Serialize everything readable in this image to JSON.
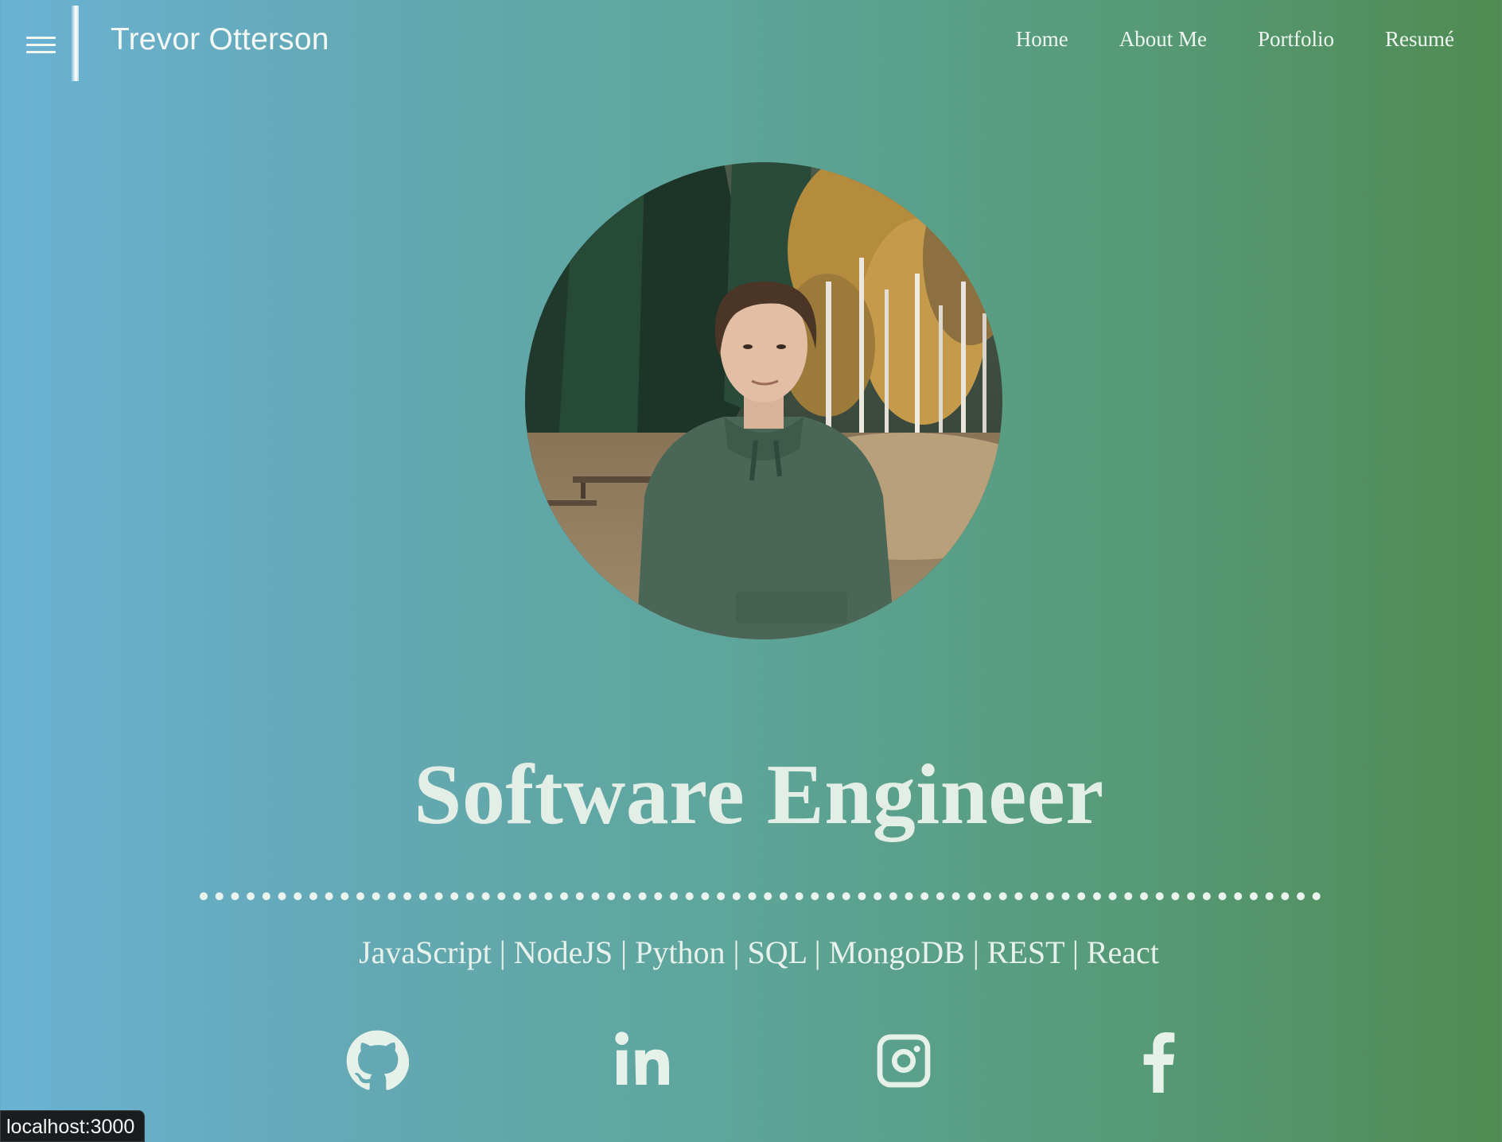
{
  "header": {
    "brand": "Trevor Otterson",
    "nav": [
      {
        "label": "Home"
      },
      {
        "label": "About Me"
      },
      {
        "label": "Portfolio"
      },
      {
        "label": "Resumé"
      }
    ]
  },
  "hero": {
    "title": "Software Engineer",
    "skills": "JavaScript | NodeJS | Python | SQL | MongoDB | REST | React",
    "social": [
      {
        "icon": "github-icon"
      },
      {
        "icon": "linkedin-icon"
      },
      {
        "icon": "instagram-icon"
      },
      {
        "icon": "facebook-icon"
      }
    ]
  },
  "status_bar": {
    "url": "localhost:3000"
  },
  "colors": {
    "gradient_start": "#6ab2d4",
    "gradient_end": "#4f8b52",
    "text": "#e6f1ea"
  }
}
